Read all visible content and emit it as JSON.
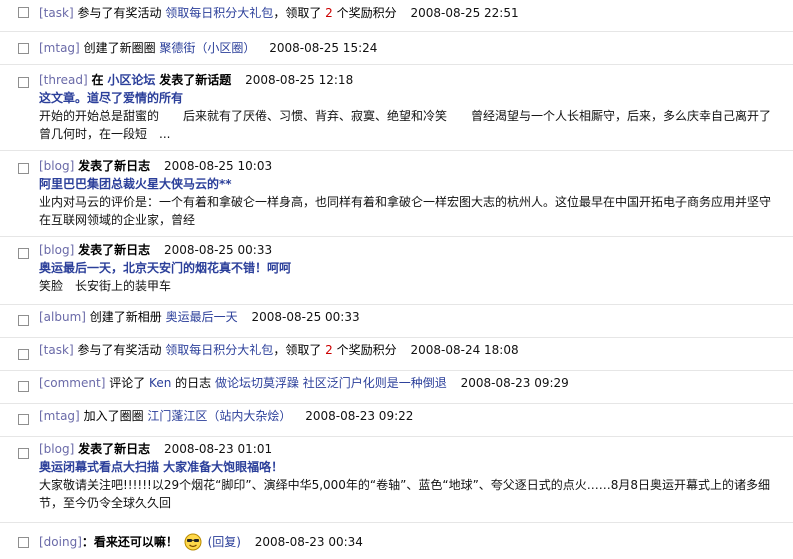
{
  "rows": [
    {
      "tag": "[task]",
      "pre": "参与了有奖活动",
      "link": "领取每日积分大礼包",
      "mid": "，领取了",
      "count": "2",
      "post": "个奖励积分",
      "time": "2008-08-25 22:51"
    },
    {
      "tag": "[mtag]",
      "pre": "创建了新圈圈",
      "link": "聚德街（小区圈）",
      "time": "2008-08-25 15:24"
    },
    {
      "tag": "[thread]",
      "b1": "在",
      "link": "小区论坛",
      "b2": "发表了新话题",
      "time": "2008-08-25 12:18",
      "title": "这文章。道尽了爱情的所有",
      "body": "开始的开始总是甜蜜的　　后来就有了厌倦、习惯、背弃、寂寞、绝望和冷笑　　曾经渴望与一个人长相厮守，后来，多么庆幸自己离开了　　曾几何时，在一段短　..."
    },
    {
      "tag": "[blog]",
      "b1": "发表了新日志",
      "time": "2008-08-25 10:03",
      "title": "阿里巴巴集团总裁火星大侠马云的**",
      "body": "业内对马云的评价是：一个有着和拿破仑一样身高，也同样有着和拿破仑一样宏图大志的杭州人。这位最早在中国开拓电子商务应用并坚守在互联网领域的企业家，曾经"
    },
    {
      "tag": "[blog]",
      "b1": "发表了新日志",
      "time": "2008-08-25 00:33",
      "title": "奥运最后一天，北京天安门的烟花真不错！呵呵",
      "body": "笑脸　长安街上的装甲车"
    },
    {
      "tag": "[album]",
      "pre": "创建了新相册",
      "link": "奥运最后一天",
      "time": "2008-08-25 00:33"
    },
    {
      "tag": "[task]",
      "pre": "参与了有奖活动",
      "link": "领取每日积分大礼包",
      "mid": "，领取了",
      "count": "2",
      "post": "个奖励积分",
      "time": "2008-08-24 18:08"
    },
    {
      "tag": "[comment]",
      "pre": "评论了",
      "link": "Ken",
      "mid2": "的日志",
      "link2": "做论坛切莫浮躁 社区泛门户化则是一种倒退",
      "time": "2008-08-23 09:29"
    },
    {
      "tag": "[mtag]",
      "pre": "加入了圈圈",
      "link": "江门蓬江区（站内大杂烩）",
      "time": "2008-08-23 09:22"
    },
    {
      "tag": "[blog]",
      "b1": "发表了新日志",
      "time": "2008-08-23 01:01",
      "title": "奥运闭幕式看点大扫描 大家准备大饱眼福咯！",
      "body": "大家敬请关注吧!!!!!!以29个烟花“脚印”、演绎中华5,000年的“卷轴”、蓝色“地球”、夸父逐日式的点火……8月8日奥运开幕式上的诸多细节，至今仍令全球久久回"
    },
    {
      "tag": "[doing]",
      "pre": "：看来还可以嘛！",
      "link": "(回复)",
      "time": "2008-08-23 00:34"
    }
  ]
}
